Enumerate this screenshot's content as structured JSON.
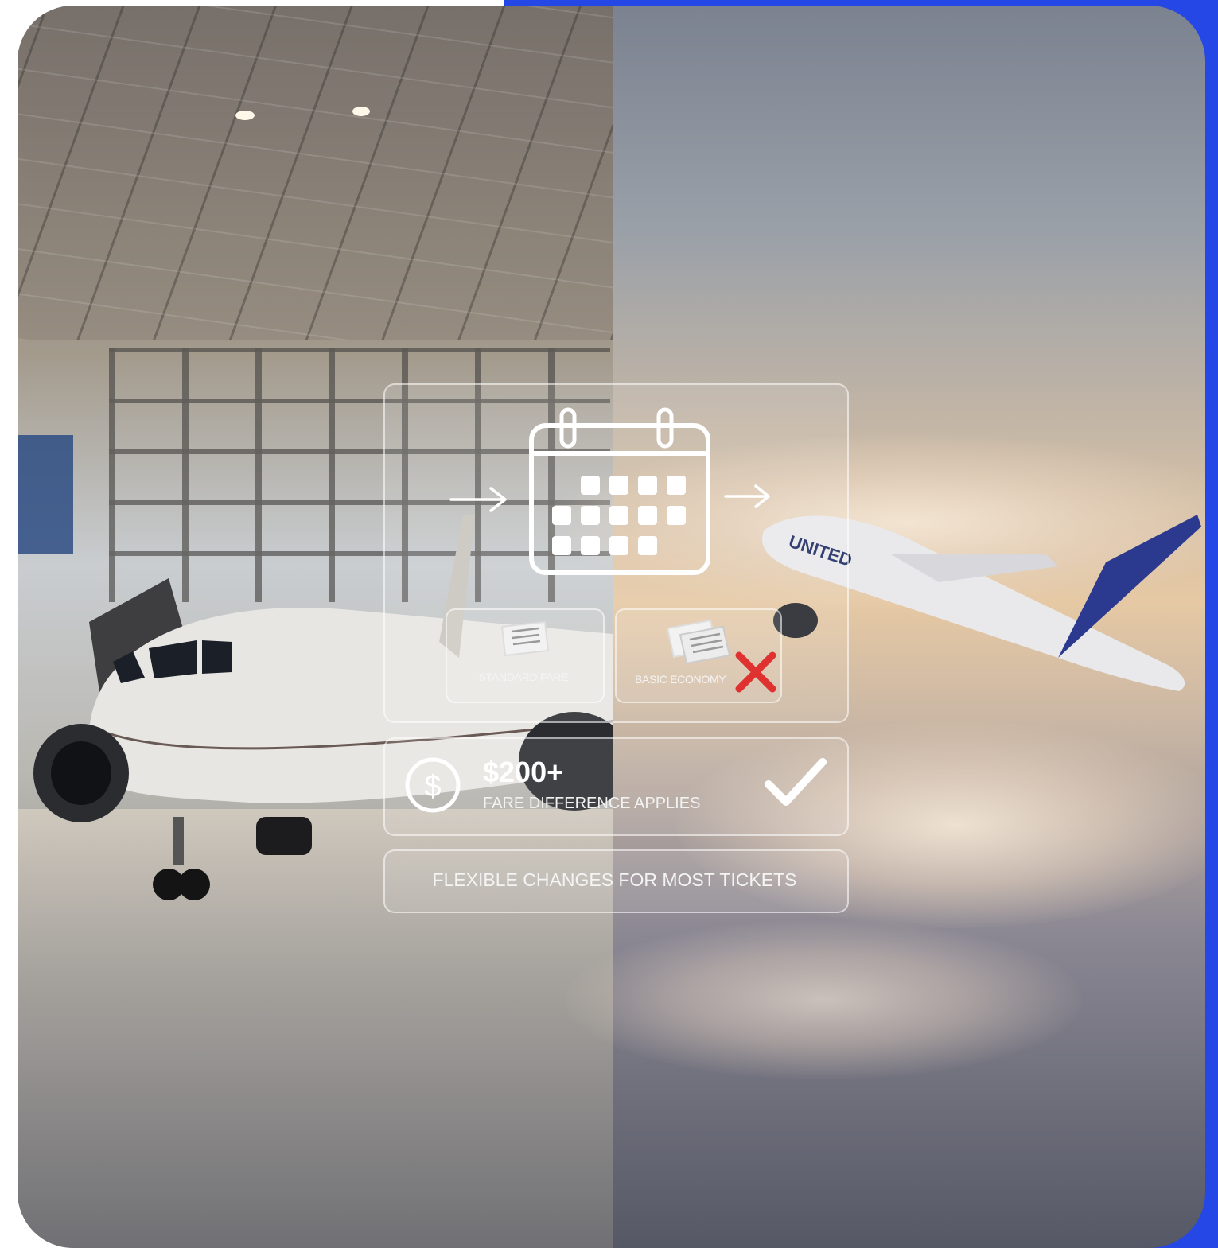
{
  "colors": {
    "frame_blue": "#2447e5",
    "check_red": "#e03131"
  },
  "icons": [
    "calendar-icon",
    "arrow-right-icon",
    "ticket-icon",
    "x-mark-icon",
    "dollar-circle-icon",
    "checkmark-icon"
  ],
  "labels": {
    "standard_fare": "STANDARD FARE",
    "basic_economy": "BASIC ECONOMY",
    "fare_amount": "$200+",
    "fare_difference": "FARE DIFFERENCE APPLIES",
    "flexible": "FLEXIBLE CHANGES FOR MOST TICKETS"
  },
  "aircraft_livery": "UNITED"
}
